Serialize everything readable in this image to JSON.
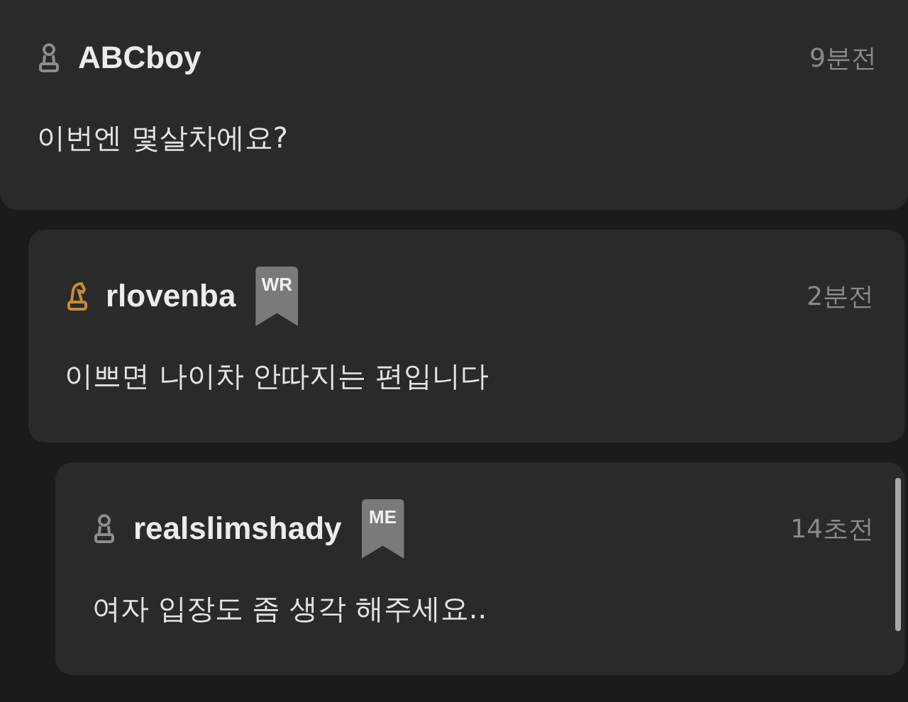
{
  "comments": [
    {
      "author": "ABCboy",
      "kind": "pawn",
      "time": "9분전",
      "text": "이번엔 몇살차에요?",
      "children": [
        {
          "author": "rlovenba",
          "kind": "knight",
          "badge": "WR",
          "time": "2분전",
          "text": "이쁘면 나이차 안따지는 편입니다",
          "children": [
            {
              "author": "realslimshady",
              "kind": "pawn",
              "badge": "ME",
              "time": "14초전",
              "text": "여자 입장도 좀 생각 해주세요.."
            }
          ]
        }
      ]
    }
  ]
}
